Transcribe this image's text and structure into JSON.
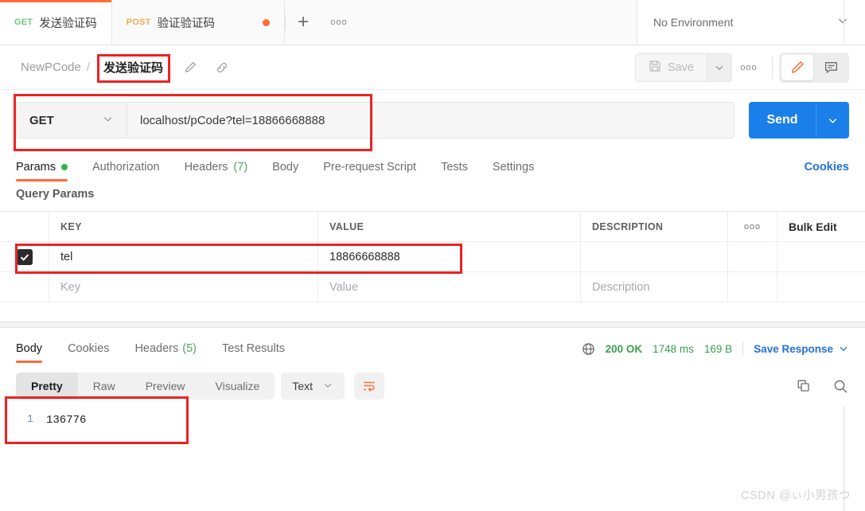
{
  "tabstrip": {
    "tabs": [
      {
        "verb": "GET",
        "title": "发送验证码",
        "active": true
      },
      {
        "verb": "POST",
        "title": "验证验证码",
        "active": false
      }
    ],
    "new_tab_label": "+",
    "more_label": "ooo",
    "environment": {
      "label": "No Environment"
    }
  },
  "breadcrumb": {
    "collection": "NewPCode",
    "separator": "/",
    "request_name": "发送验证码",
    "edit_icon": "pencil-icon",
    "link_icon": "link-icon"
  },
  "toolbar": {
    "save_label": "Save",
    "save_caret": "chevron-down-icon",
    "more_label": "ooo",
    "pencil_icon": "pencil-icon",
    "comment_icon": "comment-icon"
  },
  "request": {
    "method": "GET",
    "url": "localhost/pCode?tel=18866668888",
    "send_label": "Send",
    "send_caret": "chevron-down-icon"
  },
  "request_tabs": [
    {
      "label": "Params",
      "dot": true,
      "active": true
    },
    {
      "label": "Authorization",
      "active": false
    },
    {
      "label": "Headers",
      "count": "(7)",
      "active": false
    },
    {
      "label": "Body",
      "active": false
    },
    {
      "label": "Pre-request Script",
      "active": false
    },
    {
      "label": "Tests",
      "active": false
    },
    {
      "label": "Settings",
      "active": false
    }
  ],
  "cookies_link": "Cookies",
  "query_params": {
    "section_label": "Query Params",
    "columns": {
      "key": "KEY",
      "value": "VALUE",
      "description": "DESCRIPTION"
    },
    "options_label": "ooo",
    "bulk_edit_label": "Bulk Edit",
    "rows": [
      {
        "checked": true,
        "key": "tel",
        "value": "18866668888",
        "description": ""
      }
    ],
    "placeholders": {
      "key": "Key",
      "value": "Value",
      "description": "Description"
    }
  },
  "response": {
    "tabs": [
      {
        "label": "Body",
        "active": true
      },
      {
        "label": "Cookies",
        "active": false
      },
      {
        "label": "Headers",
        "count": "(5)",
        "active": false
      },
      {
        "label": "Test Results",
        "active": false
      }
    ],
    "status": {
      "code": "200 OK",
      "time": "1748 ms",
      "size": "169 B"
    },
    "save_response_label": "Save Response",
    "save_response_caret": "chevron-down-icon",
    "globe_icon": "globe-icon",
    "view_modes": [
      {
        "label": "Pretty",
        "active": true
      },
      {
        "label": "Raw",
        "active": false
      },
      {
        "label": "Preview",
        "active": false
      },
      {
        "label": "Visualize",
        "active": false
      }
    ],
    "format": "Text",
    "format_caret": "chevron-down-icon",
    "wrap_icon": "word-wrap-icon",
    "copy_icon": "copy-icon",
    "search_icon": "search-icon",
    "body": {
      "lines": [
        {
          "no": "1",
          "text": "136776"
        }
      ]
    }
  },
  "watermark": "CSDN @ぃ小男孩つ",
  "colors": {
    "accent_orange": "#ff6c37",
    "send_blue": "#1a7fe8",
    "link_blue": "#2470dd",
    "status_green": "#3a9e4f",
    "get_green": "#6bc77f",
    "post_orange": "#f0ad4e",
    "annotation_red": "#ee2222"
  }
}
